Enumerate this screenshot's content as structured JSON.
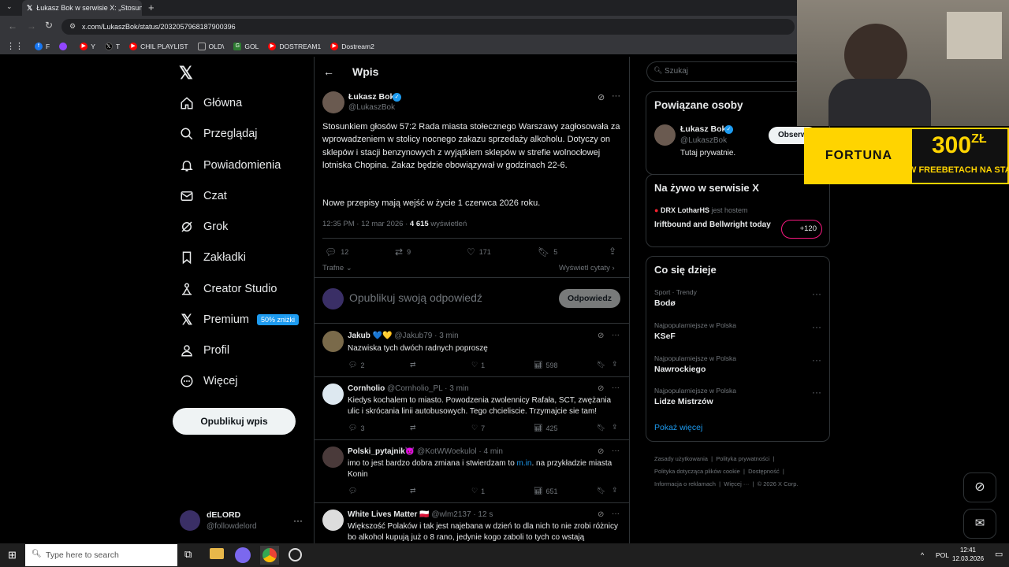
{
  "browser": {
    "tab_title": "Łukasz Bok w serwisie X: „Stosunk",
    "url": "x.com/LukaszBok/status/2032057968187900396",
    "bookmarks": [
      {
        "label": "F",
        "color": "#1877f2"
      },
      {
        "label": "",
        "color": "#9146ff"
      },
      {
        "label": "Y",
        "color": "#ff0000"
      },
      {
        "label": "T",
        "color": "#000000"
      },
      {
        "label": "CHIL PLAYLIST",
        "color": "#ff0000"
      },
      {
        "label": "OLD\\",
        "color": "#888888"
      },
      {
        "label": "GOL",
        "color": "#2e7d32"
      },
      {
        "label": "DOSTREAM1",
        "color": "#ff0000"
      },
      {
        "label": "Dostream2",
        "color": "#ff0000"
      }
    ]
  },
  "nav": {
    "items": [
      {
        "label": "Główna",
        "icon": "home-icon"
      },
      {
        "label": "Przeglądaj",
        "icon": "search-icon"
      },
      {
        "label": "Powiadomienia",
        "icon": "bell-icon"
      },
      {
        "label": "Czat",
        "icon": "mail-icon"
      },
      {
        "label": "Grok",
        "icon": "grok-icon"
      },
      {
        "label": "Zakładki",
        "icon": "bookmark-icon"
      },
      {
        "label": "Creator Studio",
        "icon": "creator-icon"
      },
      {
        "label": "Premium",
        "icon": "x-logo-icon"
      },
      {
        "label": "Profil",
        "icon": "person-icon"
      },
      {
        "label": "Więcej",
        "icon": "more-circle-icon"
      }
    ],
    "premium_badge": "50% zniżki",
    "post_button": "Opublikuj wpis",
    "account_name": "dELORD",
    "account_handle": "@followdelord"
  },
  "post": {
    "header": "Wpis",
    "author": "Łukasz Bok",
    "handle": "@LukaszBok",
    "text1": "Stosunkiem głosów 57:2 Rada miasta stołecznego Warszawy zagłosowała za wprowadzeniem w stolicy nocnego zakazu sprzedaży alkoholu. Dotyczy on sklepów i stacji benzynowych z wyjątkiem sklepów w strefie wolnocłowej lotniska Chopina. Zakaz będzie obowiązywał w godzinach 22-6.",
    "text2": "Nowe przepisy mają wejść w życie 1 czerwca 2026 roku.",
    "timestamp": "12:35 PM · 12 mar 2026 ·",
    "views": "4 615",
    "views_label": "wyświetleń",
    "replies": "12",
    "reposts": "9",
    "likes": "171",
    "bookmarks": "5",
    "sort_label": "Trafne",
    "quotes_link": "Wyświetl cytaty",
    "reply_placeholder": "Opublikuj swoją odpowiedź",
    "reply_button": "Odpowiedz"
  },
  "replies": [
    {
      "name": "Jakub 💙💛",
      "handle": "@Jakub79 · 3 min",
      "text": "Nazwiska tych dwóch radnych poproszę",
      "c": "2",
      "r": "",
      "l": "1",
      "v": "598"
    },
    {
      "name": "Cornholio",
      "handle": "@Cornholio_PL · 3 min",
      "text": "Kiedys kochalem to miasto. Powodzenia zwolennicy Rafała, SCT, zwężania ulic i skrócania linii autobusowych. Tego chcieliscie. Trzymajcie sie tam!",
      "c": "3",
      "r": "",
      "l": "7",
      "v": "425"
    },
    {
      "name": "Polski_pytajnik😈",
      "handle": "@KotWWoekulol · 4 min",
      "text_pre": "imo to jest bardzo dobra zmiana i stwierdzam to ",
      "link": "m.in",
      "text_post": ". na przykładzie miasta Konin",
      "c": "",
      "r": "",
      "l": "1",
      "v": "651"
    },
    {
      "name": "White Lives Matter 🇵🇱",
      "handle": "@wlm2137 · 12 s",
      "text": "Większość Polaków i tak jest najebana w dzień to dla nich to nie zrobi różnicy bo alkohol kupują już o 8 rano, jedynie kogo zaboli to tych co wstają"
    }
  ],
  "right": {
    "search_placeholder": "Szukaj",
    "related_title": "Powiązane osoby",
    "related_name": "Łukasz Bok",
    "related_handle": "@LukaszBok",
    "related_bio": "Tutaj prywatnie.",
    "follow_button": "Obserwuj",
    "live_title": "Na żywo w serwisie X",
    "live_host": "DRX LotharHS",
    "live_host_suffix": "jest hostem",
    "live_text": "Iriftbound and Bellwright today",
    "live_count": "+120",
    "trends_title": "Co się dzieje",
    "trends": [
      {
        "cat": "Sport · Trendy",
        "name": "Bodø"
      },
      {
        "cat": "Najpopularniejsze w Polska",
        "name": "KSeF"
      },
      {
        "cat": "Najpopularniejsze w Polska",
        "name": "Nawrockiego"
      },
      {
        "cat": "Najpopularniejsze w Polska",
        "name": "Lidze Mistrzów"
      }
    ],
    "show_more": "Pokaż więcej",
    "footer": [
      "Zasady użytkowania",
      "Polityka prywatności",
      "Polityka dotycząca plików cookie",
      "Dostępność",
      "Informacja o reklamach",
      "Więcej ···",
      "© 2026 X Corp."
    ]
  },
  "overlay": {
    "brand": "FORTUNA",
    "amount": "300",
    "currency": "ZŁ",
    "promo": "W FREEBETACH NA STA"
  },
  "taskbar": {
    "search_placeholder": "Type here to search",
    "lang": "POL",
    "time": "12:41",
    "date": "12.03.2026"
  }
}
